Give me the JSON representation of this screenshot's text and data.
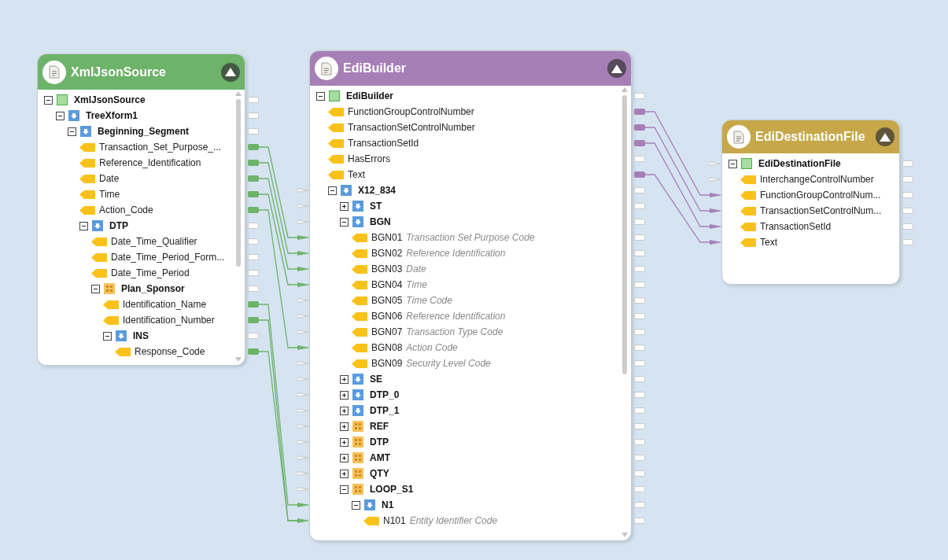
{
  "nodes": [
    {
      "title": "XmlJsonSource",
      "color": "#6db36a",
      "scrollbar": true,
      "rows": [
        {
          "label": "XmlJsonSource",
          "kind": "root",
          "expanded": true,
          "mapped": false,
          "children": [
            {
              "label": "TreeXform1",
              "kind": "element",
              "expanded": true,
              "mapped": false,
              "children": [
                {
                  "label": "Beginning_Segment",
                  "kind": "element",
                  "expanded": true,
                  "mapped": false,
                  "children": [
                    {
                      "label": "Transaction_Set_Purpose_...",
                      "kind": "field",
                      "mapped": true
                    },
                    {
                      "label": "Reference_Identification",
                      "kind": "field",
                      "mapped": true
                    },
                    {
                      "label": "Date",
                      "kind": "field",
                      "mapped": true
                    },
                    {
                      "label": "Time",
                      "kind": "field",
                      "mapped": true
                    },
                    {
                      "label": "Action_Code",
                      "kind": "field",
                      "mapped": true
                    },
                    {
                      "label": "DTP",
                      "kind": "element",
                      "expanded": true,
                      "mapped": false,
                      "children": [
                        {
                          "label": "Date_Time_Qualifier",
                          "kind": "field",
                          "mapped": false
                        },
                        {
                          "label": "Date_Time_Period_Form...",
                          "kind": "field",
                          "mapped": false
                        },
                        {
                          "label": "Date_Time_Period",
                          "kind": "field",
                          "mapped": false
                        },
                        {
                          "label": "Plan_Sponsor",
                          "kind": "loop",
                          "expanded": true,
                          "mapped": false,
                          "children": [
                            {
                              "label": "Identification_Name",
                              "kind": "field",
                              "mapped": true
                            },
                            {
                              "label": "Identification_Number",
                              "kind": "field",
                              "mapped": true
                            },
                            {
                              "label": "INS",
                              "kind": "element",
                              "expanded": true,
                              "mapped": false,
                              "children": [
                                {
                                  "label": "Response_Code",
                                  "kind": "field",
                                  "mapped": true
                                }
                              ]
                            }
                          ]
                        }
                      ]
                    }
                  ]
                }
              ]
            }
          ]
        }
      ]
    },
    {
      "title": "EdiBuilder",
      "color": "#a77fb7",
      "scrollbar": true,
      "rows": [
        {
          "label": "EdiBuilder",
          "kind": "root",
          "expanded": true,
          "mapped": false,
          "children": [
            {
              "label": "FunctionGroupControlNumber",
              "kind": "field",
              "mapped": true
            },
            {
              "label": "TransactionSetControlNumber",
              "kind": "field",
              "mapped": true
            },
            {
              "label": "TransactionSetId",
              "kind": "field",
              "mapped": true
            },
            {
              "label": "HasErrors",
              "kind": "field",
              "mapped": false
            },
            {
              "label": "Text",
              "kind": "field",
              "mapped": true
            },
            {
              "label": "X12_834",
              "kind": "element",
              "expanded": true,
              "mapped": false,
              "input_linked": false,
              "children": [
                {
                  "label": "ST",
                  "kind": "element",
                  "expanded": false,
                  "mapped": false,
                  "input_linked": false
                },
                {
                  "label": "BGN",
                  "kind": "element",
                  "expanded": true,
                  "mapped": false,
                  "input_linked": false,
                  "children": [
                    {
                      "label": "BGN01",
                      "description": "Transaction Set Purpose Code",
                      "kind": "field",
                      "mapped": false,
                      "input_linked": true
                    },
                    {
                      "label": "BGN02",
                      "description": "Reference Identification",
                      "kind": "field",
                      "mapped": false,
                      "input_linked": true
                    },
                    {
                      "label": "BGN03",
                      "description": "Date",
                      "kind": "field",
                      "mapped": false,
                      "input_linked": true
                    },
                    {
                      "label": "BGN04",
                      "description": "Time",
                      "kind": "field",
                      "mapped": false,
                      "input_linked": true
                    },
                    {
                      "label": "BGN05",
                      "description": "Time Code",
                      "kind": "field",
                      "mapped": false,
                      "input_linked": false
                    },
                    {
                      "label": "BGN06",
                      "description": "Reference Identification",
                      "kind": "field",
                      "mapped": false,
                      "input_linked": false
                    },
                    {
                      "label": "BGN07",
                      "description": "Transaction Type Code",
                      "kind": "field",
                      "mapped": false,
                      "input_linked": false
                    },
                    {
                      "label": "BGN08",
                      "description": "Action Code",
                      "kind": "field",
                      "mapped": false,
                      "input_linked": true
                    },
                    {
                      "label": "BGN09",
                      "description": "Security Level Code",
                      "kind": "field",
                      "mapped": false,
                      "input_linked": false
                    }
                  ]
                },
                {
                  "label": "SE",
                  "kind": "element",
                  "expanded": false,
                  "mapped": false,
                  "input_linked": false
                },
                {
                  "label": "DTP_0",
                  "kind": "element",
                  "expanded": false,
                  "mapped": false,
                  "input_linked": false
                },
                {
                  "label": "DTP_1",
                  "kind": "element",
                  "expanded": false,
                  "mapped": false,
                  "input_linked": false
                },
                {
                  "label": "REF",
                  "kind": "loop",
                  "expanded": false,
                  "mapped": false,
                  "input_linked": false
                },
                {
                  "label": "DTP",
                  "kind": "loop",
                  "expanded": false,
                  "mapped": false,
                  "input_linked": false
                },
                {
                  "label": "AMT",
                  "kind": "loop",
                  "expanded": false,
                  "mapped": false,
                  "input_linked": false
                },
                {
                  "label": "QTY",
                  "kind": "loop",
                  "expanded": false,
                  "mapped": false,
                  "input_linked": false
                },
                {
                  "label": "LOOP_S1",
                  "kind": "loop",
                  "expanded": true,
                  "mapped": false,
                  "input_linked": false,
                  "children": [
                    {
                      "label": "N1",
                      "kind": "element",
                      "expanded": true,
                      "mapped": false,
                      "input_linked": true,
                      "children": [
                        {
                          "label": "N101",
                          "description": "Entity Identifier Code",
                          "kind": "field",
                          "mapped": false,
                          "input_linked": true
                        }
                      ]
                    }
                  ]
                }
              ]
            }
          ]
        }
      ]
    },
    {
      "title": "EdiDestinationFile",
      "color": "#c6a84a",
      "scrollbar": false,
      "rows": [
        {
          "label": "EdiDestinationFile",
          "kind": "root",
          "expanded": true,
          "mapped": false,
          "input_linked": false,
          "children": [
            {
              "label": "InterchangeControlNumber",
              "kind": "field",
              "mapped": false,
              "input_linked": false
            },
            {
              "label": "FunctionGroupControlNum...",
              "kind": "field",
              "mapped": false,
              "input_linked": true
            },
            {
              "label": "TransactionSetControlNum...",
              "kind": "field",
              "mapped": false,
              "input_linked": true
            },
            {
              "label": "TransactionSetId",
              "kind": "field",
              "mapped": false,
              "input_linked": true
            },
            {
              "label": "Text",
              "kind": "field",
              "mapped": false,
              "input_linked": true
            }
          ]
        }
      ]
    }
  ]
}
